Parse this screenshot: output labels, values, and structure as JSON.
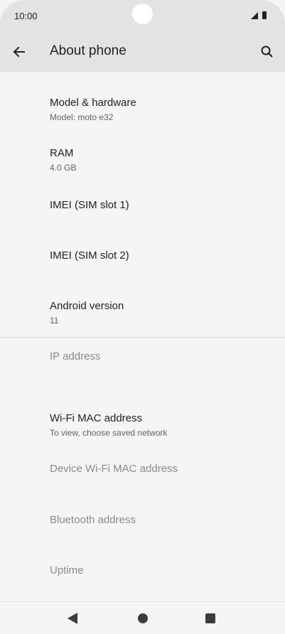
{
  "status_bar": {
    "time": "10:00",
    "icons": [
      "signal-icon",
      "battery-icon"
    ]
  },
  "app_bar": {
    "title": "About phone",
    "back_icon": "arrow-left-icon",
    "search_icon": "search-icon"
  },
  "items": [
    {
      "title": "Model & hardware",
      "summary": "Model: moto e32",
      "enabled": true
    },
    {
      "title": "RAM",
      "summary": "4.0 GB",
      "enabled": true
    },
    {
      "title": "IMEI (SIM slot 1)",
      "summary": "",
      "enabled": true
    },
    {
      "title": "IMEI (SIM slot 2)",
      "summary": "",
      "enabled": true
    },
    {
      "title": "Android version",
      "summary": "11",
      "enabled": true
    },
    {
      "title": "IP address",
      "summary": "",
      "enabled": false
    },
    {
      "title": "Wi-Fi MAC address",
      "summary": "To view, choose saved network",
      "enabled": true
    },
    {
      "title": "Device Wi-Fi MAC address",
      "summary": "",
      "enabled": false
    },
    {
      "title": "Bluetooth address",
      "summary": "",
      "enabled": false
    },
    {
      "title": "Uptime",
      "summary": "",
      "enabled": false
    }
  ],
  "nav_bar": {
    "icons": [
      "back-triangle-icon",
      "home-circle-icon",
      "recents-square-icon"
    ]
  },
  "colors": {
    "app_bar_bg": "#e3e3e3",
    "page_bg": "#f5f5f5",
    "disabled_text": "#8a8a8a"
  }
}
